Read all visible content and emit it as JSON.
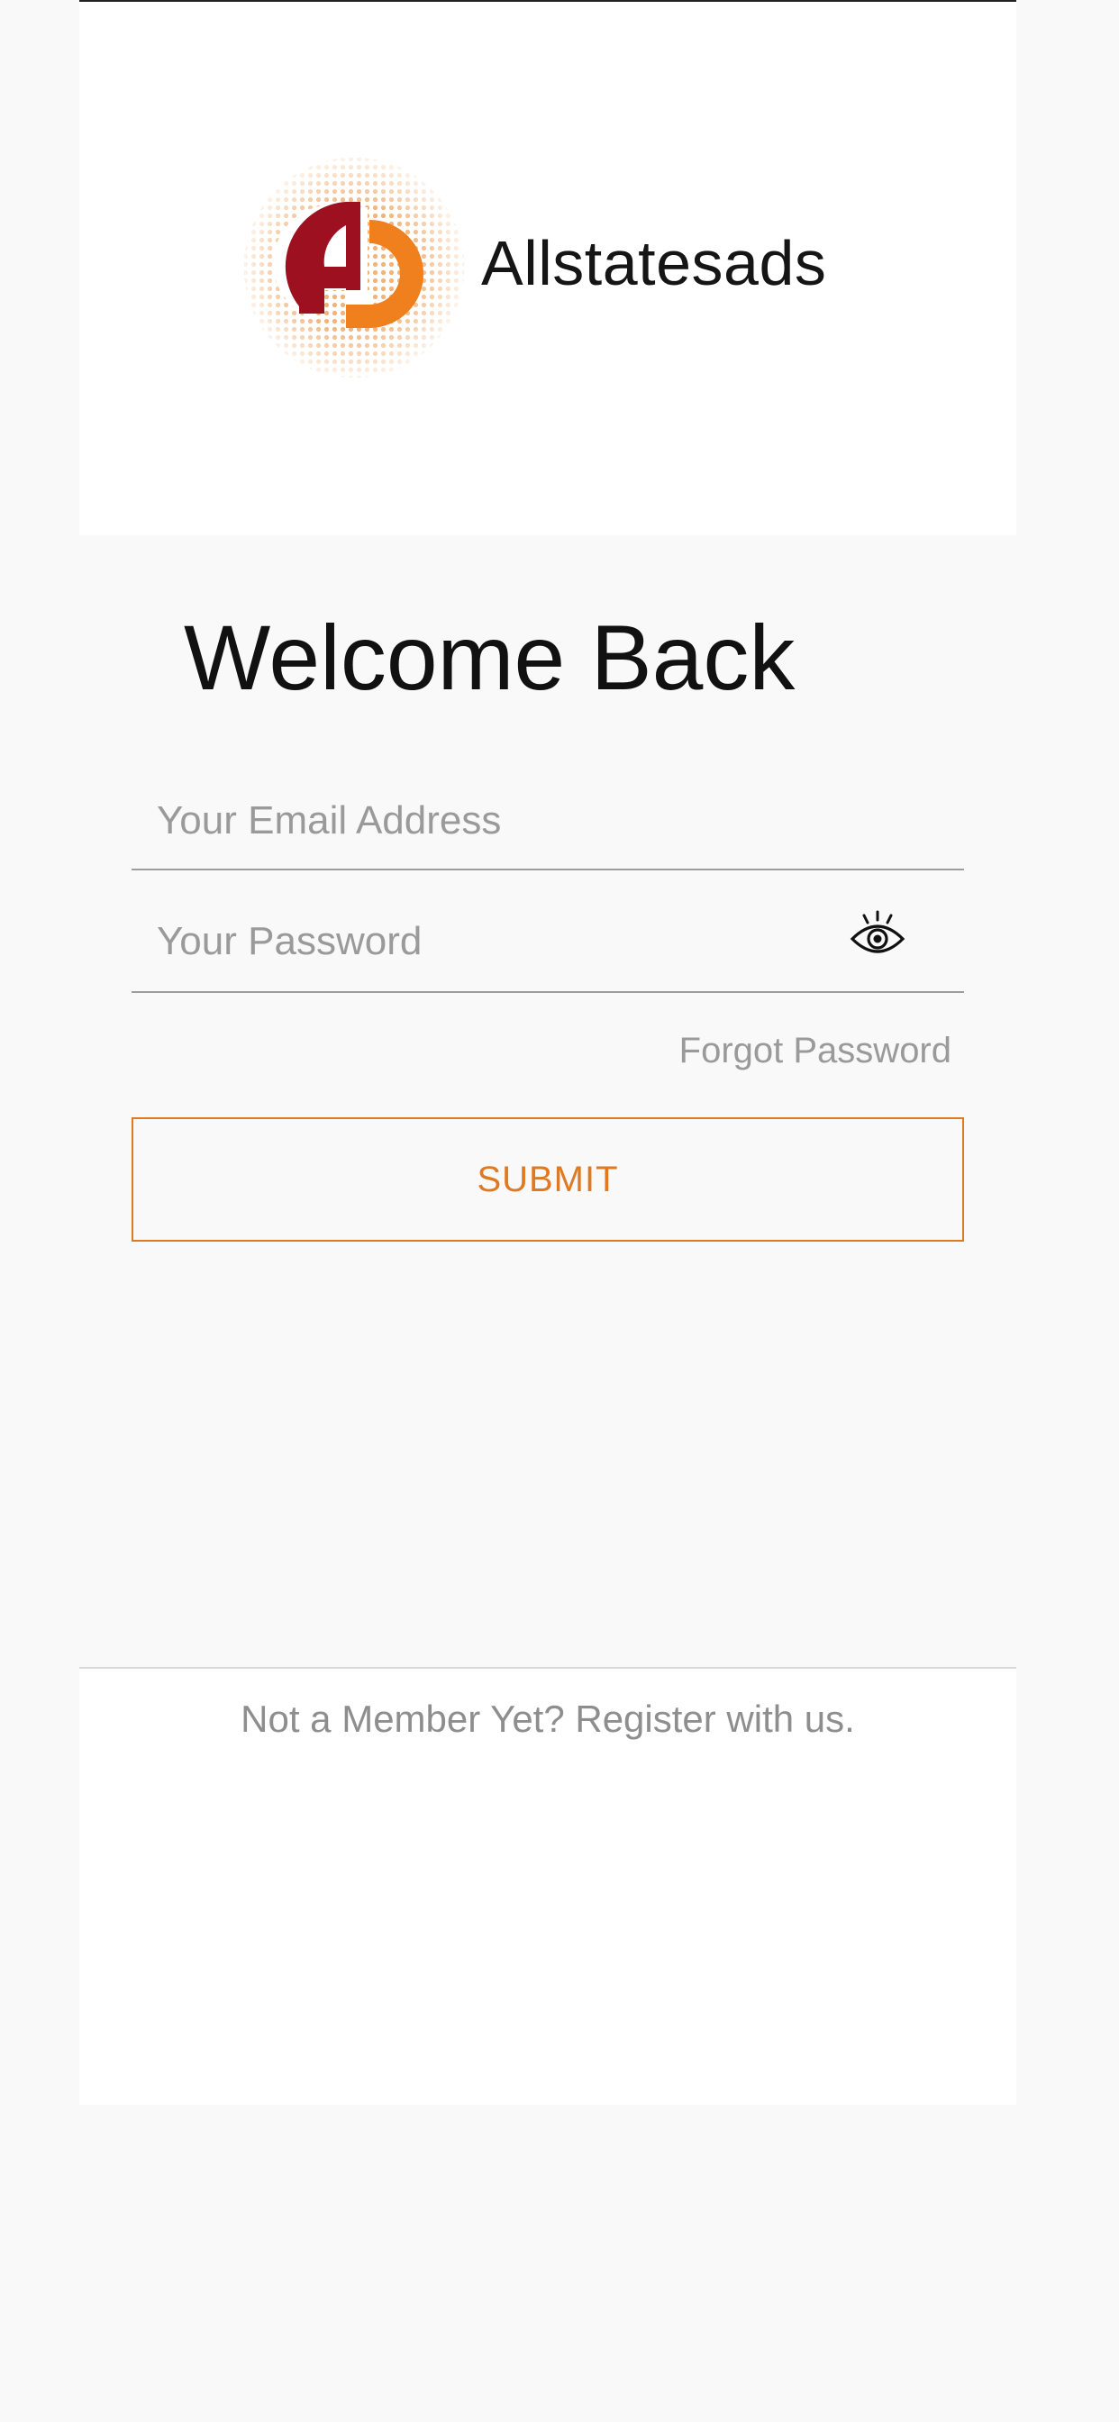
{
  "brand": {
    "name": "Allstatesads",
    "logo_icon": "ad-globe-logo",
    "colors": {
      "dark_red": "#9c1020",
      "orange": "#f07f1e",
      "dots": "#f2b37a"
    }
  },
  "login": {
    "title": "Welcome Back",
    "email_placeholder": "Your Email Address",
    "password_placeholder": "Your Password",
    "password_toggle_icon": "eye-icon",
    "forgot_label": "Forgot Password",
    "submit_label": "SUBMIT",
    "accent_color": "#e07a22"
  },
  "footer": {
    "register_label": "Not a Member Yet? Register with us."
  }
}
